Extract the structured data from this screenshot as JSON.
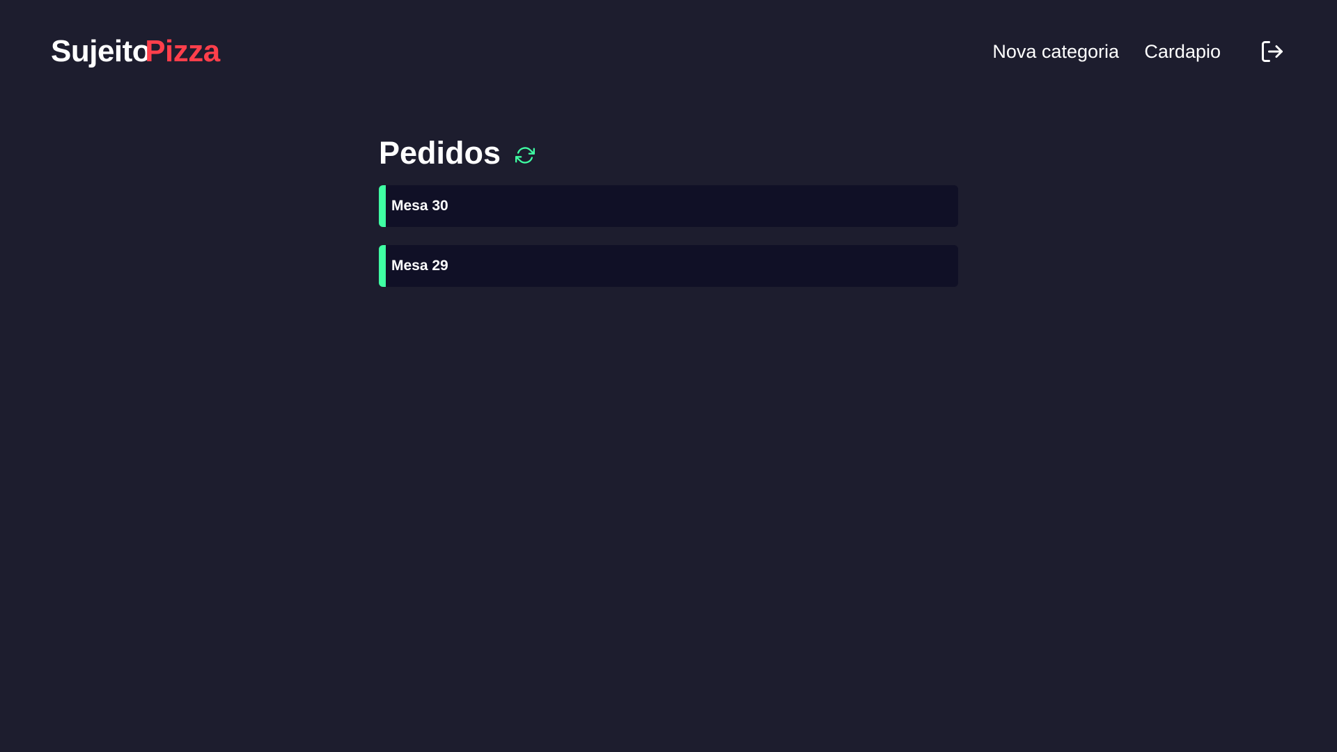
{
  "header": {
    "logo_part1": "Sujeito",
    "logo_part2": "Pizza",
    "nav": {
      "new_category": "Nova categoria",
      "menu": "Cardapio"
    },
    "logout_icon": "logout-icon"
  },
  "main": {
    "title": "Pedidos",
    "refresh_icon": "refresh-icon",
    "orders": [
      {
        "label": "Mesa 30"
      },
      {
        "label": "Mesa 29"
      }
    ]
  },
  "colors": {
    "background": "#1d1d2e",
    "card": "#101026",
    "accent_red": "#ff3f4b",
    "accent_green": "#3fffa3",
    "text": "#ffffff"
  }
}
